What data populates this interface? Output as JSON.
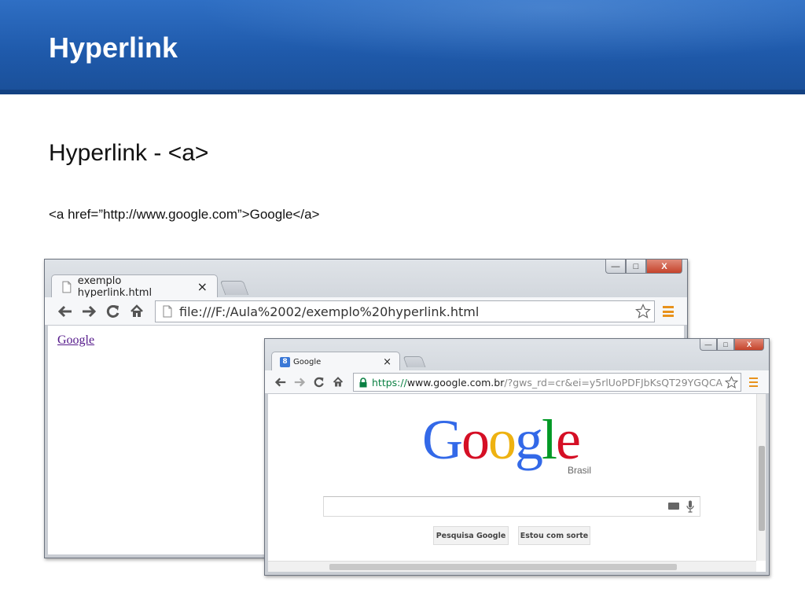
{
  "slide": {
    "title": "Hyperlink",
    "subtitle": "Hyperlink - <a>",
    "code": "<a href=”http://www.google.com”>Google</a>"
  },
  "browser1": {
    "tab_title": "exemplo hyperlink.html",
    "tab_close": "×",
    "url": "file:///F:/Aula%2002/exemplo%20hyperlink.html",
    "link_text": "Google",
    "window_controls": {
      "minimize": "—",
      "maximize": "□",
      "close": "X"
    }
  },
  "browser2": {
    "tab_title": "Google",
    "tab_close": "×",
    "url_scheme": "https://",
    "url_host": "www.google.com.br",
    "url_path": "/?gws_rd=cr&ei=y5rlUoPDFJbKsQT29YGQCA",
    "logo_letters": [
      "G",
      "o",
      "o",
      "g",
      "l",
      "e"
    ],
    "logo_country": "Brasil",
    "buttons": [
      "Pesquisa Google",
      "Estou com sorte"
    ],
    "window_controls": {
      "minimize": "—",
      "maximize": "□",
      "close": "X"
    }
  },
  "icons": {
    "back": "back-arrow-icon",
    "forward": "forward-arrow-icon",
    "reload": "reload-icon",
    "home": "home-icon",
    "page": "page-icon",
    "lock": "lock-icon",
    "star": "star-icon",
    "menu": "menu-icon"
  },
  "colors": {
    "header_blue": "#1f5aab",
    "link_visited": "#551a8b",
    "secure_green": "#0b8043",
    "google_blue": "#3369e8",
    "google_red": "#d50f25",
    "google_yellow": "#eeb211",
    "google_green": "#009925",
    "menu_orange": "#e8921c"
  }
}
